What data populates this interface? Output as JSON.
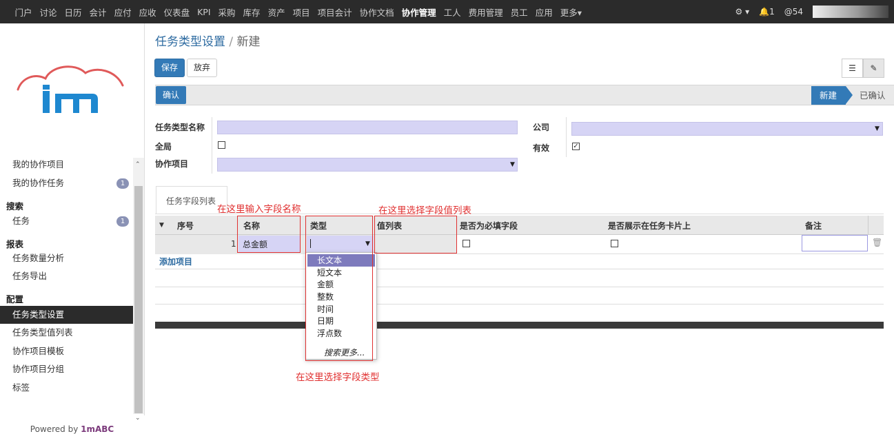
{
  "topbar": {
    "menu": [
      "门户",
      "讨论",
      "日历",
      "会计",
      "应付",
      "应收",
      "仪表盘",
      "KPI",
      "采购",
      "库存",
      "资产",
      "项目",
      "项目会计",
      "协作文档",
      "协作管理",
      "工人",
      "费用管理",
      "员工",
      "应用",
      "更多▾"
    ],
    "active": "协作管理",
    "settings": "⚙ ▾",
    "notifications": "🔔1",
    "mentions": "@54",
    "icons": [
      "gear-icon",
      "bell-icon",
      "at-icon"
    ]
  },
  "sidebar": {
    "items": [
      {
        "type": "item",
        "label": "我的协作项目"
      },
      {
        "type": "item",
        "label": "我的协作任务",
        "badge": "1"
      },
      {
        "type": "head",
        "label": "搜索"
      },
      {
        "type": "item",
        "label": "任务",
        "badge": "1"
      },
      {
        "type": "head",
        "label": "报表"
      },
      {
        "type": "item",
        "label": "任务数量分析"
      },
      {
        "type": "item",
        "label": "任务导出"
      },
      {
        "type": "head",
        "label": "配置"
      },
      {
        "type": "item",
        "label": "任务类型设置",
        "active": true
      },
      {
        "type": "item",
        "label": "任务类型值列表"
      },
      {
        "type": "item",
        "label": "协作项目模板"
      },
      {
        "type": "item",
        "label": "协作项目分组"
      },
      {
        "type": "item",
        "label": "标签"
      }
    ],
    "powered_prefix": "Powered by ",
    "powered_brand": "1mABC"
  },
  "breadcrumb": {
    "parent": "任务类型设置",
    "sep": "/",
    "current": "新建"
  },
  "toolbar": {
    "save": "保存",
    "discard": "放弃",
    "list_icon": "☰",
    "form_icon": "✎"
  },
  "status": {
    "confirm": "确认",
    "stage_new": "新建",
    "stage_done": "已确认"
  },
  "form": {
    "name_label": "任务类型名称",
    "company_label": "公司",
    "global_label": "全局",
    "active_label": "有效",
    "active_checked": "✓",
    "project_label": "协作项目"
  },
  "tabs": {
    "fields": "任务字段列表"
  },
  "table": {
    "headers": {
      "seq": "序号",
      "name": "名称",
      "type": "类型",
      "valuelist": "值列表",
      "required": "是否为必填字段",
      "show_card": "是否展示在任务卡片上",
      "note": "备注"
    },
    "rows": [
      {
        "seq": "1",
        "name": "总金额",
        "type": ""
      }
    ],
    "add_item": "添加项目"
  },
  "dropdown": {
    "options": [
      "长文本",
      "短文本",
      "金额",
      "整数",
      "时间",
      "日期",
      "浮点数"
    ],
    "selected": "长文本",
    "more": "搜索更多..."
  },
  "annotations": {
    "name_hint": "在这里输入字段名称",
    "valuelist_hint": "在这里选择字段值列表",
    "type_hint": "在这里选择字段类型"
  },
  "colors": {
    "primary": "#337ab7",
    "input_bg": "#d6d4f5",
    "annotation": "#e03030",
    "topbar": "#2b2b2b"
  }
}
